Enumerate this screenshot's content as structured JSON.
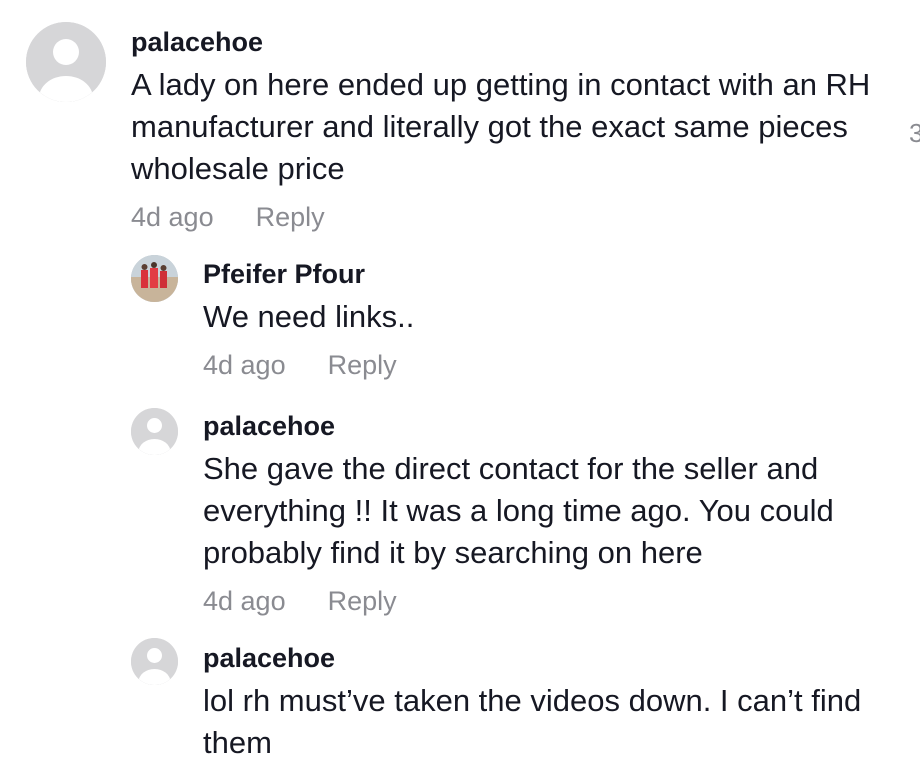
{
  "comments": [
    {
      "username": "palacehoe",
      "text": "A lady on here ended up getting in contact with an RH manufacturer and literally got the exact same pieces wholesale price",
      "time": "4d ago",
      "reply_label": "Reply"
    },
    {
      "username": "Pfeifer Pfour",
      "text": "We need links..",
      "time": "4d ago",
      "reply_label": "Reply"
    },
    {
      "username": "palacehoe",
      "text": "She gave the direct contact for the seller and everything !! It was a long time ago. You could probably find it by searching on here",
      "time": "4d ago",
      "reply_label": "Reply"
    },
    {
      "username": "palacehoe",
      "text": "lol rh must’ve taken the videos down. I can’t find them"
    }
  ],
  "like_count_partial": "3",
  "icons": {
    "default_avatar": "default-avatar-icon",
    "photo_avatar": "profile-photo-avatar"
  }
}
